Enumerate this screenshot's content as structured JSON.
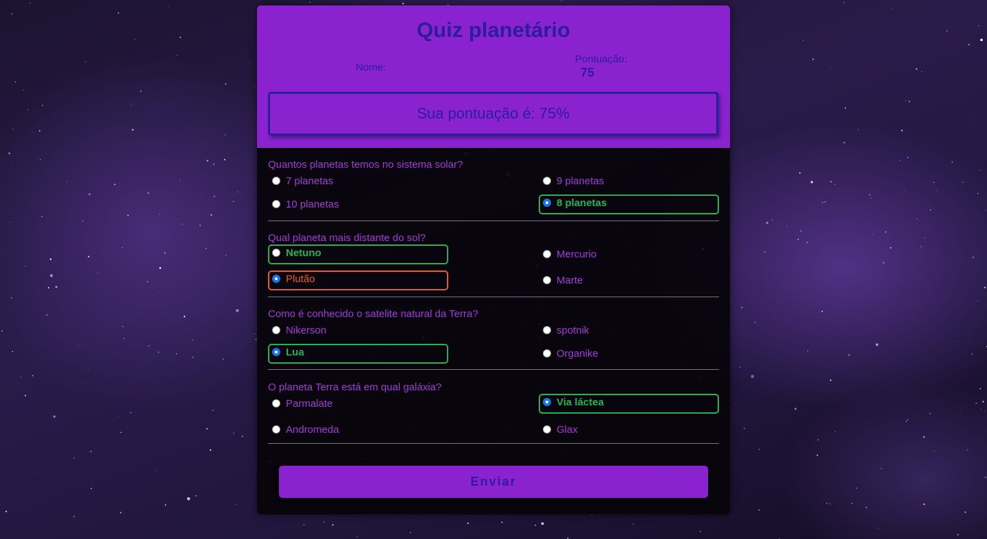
{
  "quiz": {
    "title": "Quiz planetário",
    "name_label": "Nome:",
    "score_label": "Pontuação:",
    "score_value": "75",
    "result_text": "Sua pontuação é: 75%",
    "submit_label": "Enviar"
  },
  "questions": [
    {
      "text": "Quantos planetas temos no sistema solar?",
      "options": [
        {
          "label": "7 planetas",
          "checked": false,
          "status": "none"
        },
        {
          "label": "9 planetas",
          "checked": false,
          "status": "none"
        },
        {
          "label": "10 planetas",
          "checked": false,
          "status": "none"
        },
        {
          "label": "8 planetas",
          "checked": true,
          "status": "correct"
        }
      ]
    },
    {
      "text": "Qual planeta mais distante do sol?",
      "options": [
        {
          "label": "Netuno",
          "checked": false,
          "status": "correct"
        },
        {
          "label": "Mercurio",
          "checked": false,
          "status": "none"
        },
        {
          "label": "Plutão",
          "checked": true,
          "status": "wrong"
        },
        {
          "label": "Marte",
          "checked": false,
          "status": "none"
        }
      ]
    },
    {
      "text": "Como é conhecido o satelite natural da Terra?",
      "options": [
        {
          "label": "Nikerson",
          "checked": false,
          "status": "none"
        },
        {
          "label": "spotnik",
          "checked": false,
          "status": "none"
        },
        {
          "label": "Lua",
          "checked": true,
          "status": "correct"
        },
        {
          "label": "Organike",
          "checked": false,
          "status": "none"
        }
      ]
    },
    {
      "text": "O planeta Terra está em qual galáxia?",
      "options": [
        {
          "label": "Parmalate",
          "checked": false,
          "status": "none"
        },
        {
          "label": "Via láctea",
          "checked": true,
          "status": "correct"
        },
        {
          "label": "Andromeda",
          "checked": false,
          "status": "none"
        },
        {
          "label": "Glax",
          "checked": false,
          "status": "none"
        }
      ]
    }
  ],
  "colors": {
    "header_bg": "#8b22d0",
    "title_text": "#2b1d9c",
    "question_text": "#a13ad8",
    "correct": "#22b454",
    "wrong": "#f05a1e",
    "radio_checked": "#1a73e8"
  }
}
